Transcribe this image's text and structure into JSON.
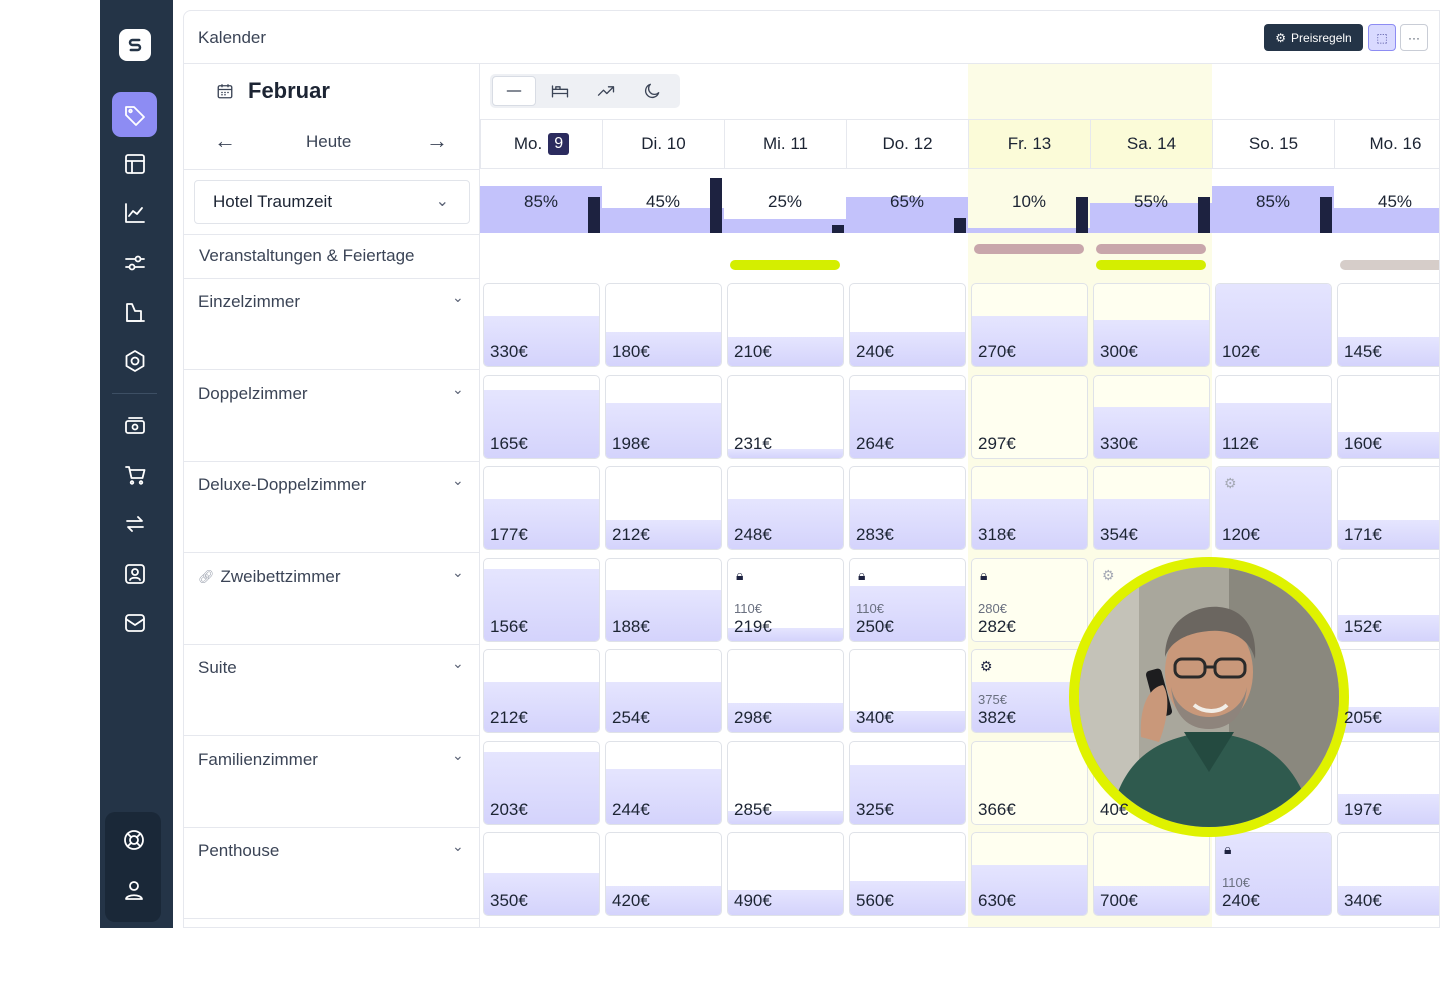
{
  "rail": {
    "items": [
      {
        "name": "pricing-tag-icon",
        "active": true
      },
      {
        "name": "layout-icon"
      },
      {
        "name": "chart-icon"
      },
      {
        "name": "sliders-icon"
      },
      {
        "name": "building-icon"
      },
      {
        "name": "settings-icon"
      },
      {
        "name": "money-icon"
      },
      {
        "name": "cart-icon"
      },
      {
        "name": "sync-icon"
      },
      {
        "name": "contact-icon"
      },
      {
        "name": "mail-icon"
      }
    ],
    "bottom": [
      {
        "name": "support-icon"
      },
      {
        "name": "user-icon"
      }
    ]
  },
  "header": {
    "title": "Kalender",
    "rules_button": "Preisregeln",
    "more_button": "···"
  },
  "calendar": {
    "month": "Februar",
    "today_label": "Heute",
    "hotel": "Hotel Traumzeit",
    "events_label": "Veranstaltungen & Feiertage",
    "days": [
      {
        "label": "Mo.",
        "num": "9",
        "today": true,
        "highlight": false,
        "occ": "85%",
        "occ_level": 0.85,
        "bar_level": 0.65
      },
      {
        "label": "Di. 10",
        "num": "",
        "today": false,
        "highlight": false,
        "occ": "45%",
        "occ_level": 0.45,
        "bar_level": 1.0
      },
      {
        "label": "Mi. 11",
        "num": "",
        "today": false,
        "highlight": false,
        "occ": "25%",
        "occ_level": 0.25,
        "bar_level": 0.15
      },
      {
        "label": "Do. 12",
        "num": "",
        "today": false,
        "highlight": false,
        "occ": "65%",
        "occ_level": 0.65,
        "bar_level": 0.28
      },
      {
        "label": "Fr. 13",
        "num": "",
        "today": false,
        "highlight": true,
        "occ": "10%",
        "occ_level": 0.1,
        "bar_level": 0.65
      },
      {
        "label": "Sa. 14",
        "num": "",
        "today": false,
        "highlight": true,
        "occ": "55%",
        "occ_level": 0.55,
        "bar_level": 0.65
      },
      {
        "label": "So. 15",
        "num": "",
        "today": false,
        "highlight": false,
        "occ": "85%",
        "occ_level": 0.85,
        "bar_level": 0.65
      },
      {
        "label": "Mo. 16",
        "num": "",
        "today": false,
        "highlight": false,
        "occ": "45%",
        "occ_level": 0.45,
        "bar_level": 0.0
      }
    ],
    "events": [
      {
        "start": 2,
        "span": 1,
        "color": "#d4ee00",
        "row": 1
      },
      {
        "start": 4,
        "span": 1,
        "color": "#c8a6ab",
        "row": 0
      },
      {
        "start": 5,
        "span": 1,
        "color": "#c8a6ab",
        "row": 0
      },
      {
        "start": 5,
        "span": 1,
        "color": "#d4ee00",
        "row": 1
      },
      {
        "start": 7,
        "span": 1,
        "color": "#d6cdc9",
        "row": 1
      }
    ],
    "rooms": [
      {
        "name": "Einzelzimmer",
        "link": false,
        "cells": [
          {
            "price": "330€",
            "fill": 0.6
          },
          {
            "price": "180€",
            "fill": 0.4
          },
          {
            "price": "210€",
            "fill": 0.35
          },
          {
            "price": "240€",
            "fill": 0.4
          },
          {
            "price": "270€",
            "fill": 0.6
          },
          {
            "price": "300€",
            "fill": 0.55
          },
          {
            "price": "102€",
            "fill": 1.0
          },
          {
            "price": "145€",
            "fill": 0.35
          }
        ]
      },
      {
        "name": "Doppelzimmer",
        "link": false,
        "cells": [
          {
            "price": "165€",
            "fill": 0.8
          },
          {
            "price": "198€",
            "fill": 0.65
          },
          {
            "price": "231€",
            "fill": 0.1
          },
          {
            "price": "264€",
            "fill": 0.8
          },
          {
            "price": "297€",
            "fill": 0.0
          },
          {
            "price": "330€",
            "fill": 0.6
          },
          {
            "price": "112€",
            "fill": 0.65
          },
          {
            "price": "160€",
            "fill": 0.3
          }
        ]
      },
      {
        "name": "Deluxe-Doppelzimmer",
        "link": false,
        "cells": [
          {
            "price": "177€",
            "fill": 0.6
          },
          {
            "price": "212€",
            "fill": 0.35
          },
          {
            "price": "248€",
            "fill": 0.6
          },
          {
            "price": "283€",
            "fill": 0.6
          },
          {
            "price": "318€",
            "fill": 0.6
          },
          {
            "price": "354€",
            "fill": 0.6
          },
          {
            "price": "120€",
            "fill": 1.0,
            "icon": "gear",
            "iconLight": true
          },
          {
            "price": "171€",
            "fill": 0.35
          }
        ]
      },
      {
        "name": "Zweibettzimmer",
        "link": true,
        "cells": [
          {
            "price": "156€",
            "fill": 0.85
          },
          {
            "price": "188€",
            "fill": 0.6
          },
          {
            "price": "219€",
            "old": "110€",
            "fill": 0.15,
            "icon": "lock"
          },
          {
            "price": "250€",
            "old": "110€",
            "fill": 0.65,
            "icon": "lock"
          },
          {
            "price": "282€",
            "old": "280€",
            "fill": 0.0,
            "icon": "lock"
          },
          {
            "price": "",
            "fill": 0.0,
            "icon": "gear",
            "iconLight": true
          },
          {
            "price": "",
            "fill": 0.0
          },
          {
            "price": "152€",
            "fill": 0.3
          }
        ]
      },
      {
        "name": "Suite",
        "link": false,
        "cells": [
          {
            "price": "212€",
            "fill": 0.6
          },
          {
            "price": "254€",
            "fill": 0.6
          },
          {
            "price": "298€",
            "fill": 0.35
          },
          {
            "price": "340€",
            "fill": 0.25
          },
          {
            "price": "382€",
            "old": "375€",
            "fill": 0.6,
            "icon": "gear"
          },
          {
            "price": "",
            "fill": 0.0
          },
          {
            "price": "",
            "fill": 0.0
          },
          {
            "price": "205€",
            "fill": 0.3
          }
        ]
      },
      {
        "name": "Familienzimmer",
        "link": false,
        "cells": [
          {
            "price": "203€",
            "fill": 0.85
          },
          {
            "price": "244€",
            "fill": 0.65
          },
          {
            "price": "285€",
            "fill": 0.15
          },
          {
            "price": "325€",
            "fill": 0.7
          },
          {
            "price": "366€",
            "fill": 0.0
          },
          {
            "price": "40€",
            "fill": 0.0
          },
          {
            "price": "",
            "fill": 0.0
          },
          {
            "price": "197€",
            "fill": 0.35
          }
        ]
      },
      {
        "name": "Penthouse",
        "link": false,
        "cells": [
          {
            "price": "350€",
            "fill": 0.5
          },
          {
            "price": "420€",
            "fill": 0.35
          },
          {
            "price": "490€",
            "fill": 0.3
          },
          {
            "price": "560€",
            "fill": 0.4
          },
          {
            "price": "630€",
            "fill": 0.6
          },
          {
            "price": "700€",
            "fill": 0.35
          },
          {
            "price": "240€",
            "old": "110€",
            "fill": 1.0,
            "icon": "lock"
          },
          {
            "price": "340€",
            "fill": 0.35
          }
        ]
      }
    ]
  },
  "colors": {
    "rail": "#243447",
    "accent": "#8d8cf3",
    "occupancy": "#c3c2fb",
    "highlight": "#fbfbd8",
    "photo_ring": "#dff200"
  }
}
